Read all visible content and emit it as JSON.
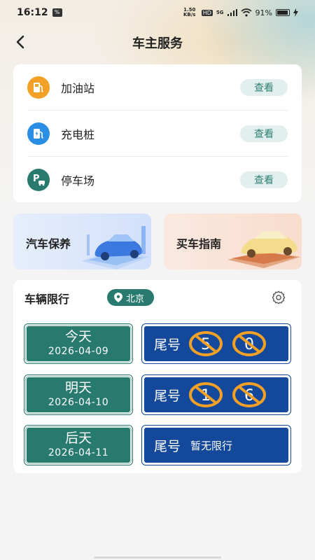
{
  "status_bar": {
    "time": "16:12",
    "speed": "1.50 KB/s",
    "network": "5G",
    "battery": "91%"
  },
  "nav": {
    "title": "车主服务"
  },
  "services": [
    {
      "label": "加油站",
      "action": "查看",
      "icon": "gas-station-icon",
      "color": "#f3a126"
    },
    {
      "label": "充电桩",
      "action": "查看",
      "icon": "charging-pile-icon",
      "color": "#2b8ee6"
    },
    {
      "label": "停车场",
      "action": "查看",
      "icon": "parking-icon",
      "color": "#277a6d"
    }
  ],
  "banners": [
    {
      "label": "汽车保养"
    },
    {
      "label": "买车指南"
    }
  ],
  "restriction": {
    "title": "车辆限行",
    "city": "北京",
    "days": [
      {
        "name": "今天",
        "date": "2026-04-09",
        "tail_label": "尾号",
        "digits": [
          "5",
          "0"
        ]
      },
      {
        "name": "明天",
        "date": "2026-04-10",
        "tail_label": "尾号",
        "digits": [
          "1",
          "6"
        ]
      },
      {
        "name": "后天",
        "date": "2026-04-11",
        "tail_label": "尾号",
        "no_limit": "暂无限行"
      }
    ]
  },
  "colors": {
    "accent": "#277a6d",
    "plate_blue": "#13489a",
    "plate_green": "#277a6d",
    "digit_circle": "#f3a126"
  }
}
